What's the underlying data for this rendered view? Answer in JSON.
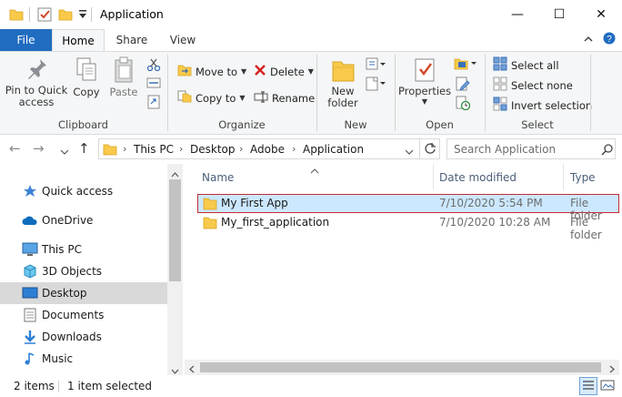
{
  "window": {
    "title": "Application",
    "minimize": "—",
    "maximize": "☐",
    "close": "✕"
  },
  "ribbon_tabs": [
    "File",
    "Home",
    "Share",
    "View"
  ],
  "ribbon": {
    "clipboard": {
      "group_label": "Clipboard",
      "pin_line1": "Pin to Quick",
      "pin_line2": "access",
      "copy": "Copy",
      "paste": "Paste"
    },
    "organize": {
      "group_label": "Organize",
      "move_to": "Move to",
      "delete": "Delete",
      "copy_to": "Copy to",
      "rename": "Rename"
    },
    "new": {
      "group_label": "New",
      "new_folder_line1": "New",
      "new_folder_line2": "folder"
    },
    "open": {
      "group_label": "Open",
      "properties": "Properties"
    },
    "select": {
      "group_label": "Select",
      "select_all": "Select all",
      "select_none": "Select none",
      "invert_selection": "Invert selection"
    }
  },
  "address": {
    "breadcrumbs": [
      "This PC",
      "Desktop",
      "Adobe",
      "Application"
    ],
    "search_placeholder": "Search Application"
  },
  "nav_pane": {
    "items": [
      {
        "label": "Quick access",
        "icon": "star-icon"
      },
      {
        "label": "OneDrive",
        "icon": "cloud-icon"
      },
      {
        "label": "This PC",
        "icon": "computer-icon"
      },
      {
        "label": "3D Objects",
        "icon": "cube-icon"
      },
      {
        "label": "Desktop",
        "icon": "desktop-icon",
        "selected": true
      },
      {
        "label": "Documents",
        "icon": "document-icon"
      },
      {
        "label": "Downloads",
        "icon": "download-icon"
      },
      {
        "label": "Music",
        "icon": "music-icon"
      }
    ]
  },
  "file_list": {
    "columns": [
      "Name",
      "Date modified",
      "Type"
    ],
    "rows": [
      {
        "name": "My First App",
        "date": "7/10/2020 5:54 PM",
        "type": "File folder",
        "selected": true
      },
      {
        "name": "My_first_application",
        "date": "7/10/2020 10:28 AM",
        "type": "File folder",
        "selected": false
      }
    ]
  },
  "status_bar": {
    "item_count": "2 items",
    "selection": "1 item selected"
  },
  "colors": {
    "file_tab": "#1f6cc0",
    "folder_yellow": "#f8c94a",
    "selection_fill": "#cce8ff",
    "selection_border": "#c42b37"
  }
}
